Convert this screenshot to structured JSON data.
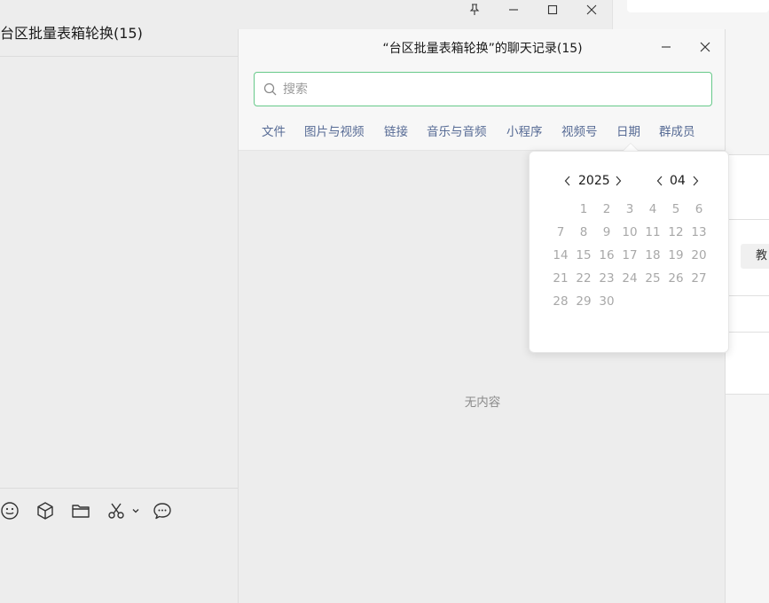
{
  "chat": {
    "title": "台区批量表箱轮换(15)"
  },
  "right_panel": {
    "chip_label": "教"
  },
  "dialog": {
    "title": "“台区批量表箱轮换”的聊天记录(15)",
    "search_placeholder": "搜索",
    "tabs": [
      "文件",
      "图片与视频",
      "链接",
      "音乐与音频",
      "小程序",
      "视频号",
      "日期",
      "群成员"
    ],
    "empty_text": "无内容"
  },
  "date_picker": {
    "year": "2025",
    "month": "04",
    "days": [
      [
        "",
        "1",
        "2",
        "3",
        "4",
        "5",
        "6"
      ],
      [
        "7",
        "8",
        "9",
        "10",
        "11",
        "12",
        "13"
      ],
      [
        "14",
        "15",
        "16",
        "17",
        "18",
        "19",
        "20"
      ],
      [
        "21",
        "22",
        "23",
        "24",
        "25",
        "26",
        "27"
      ],
      [
        "28",
        "29",
        "30",
        "",
        "",
        "",
        ""
      ]
    ]
  },
  "colors": {
    "accent_green": "#67c98a",
    "link_blue": "#576b95",
    "disabled_gray": "#a8a8a8"
  },
  "icons": {
    "window_controls": [
      "pin-icon",
      "minimize-icon",
      "maximize-icon",
      "close-icon"
    ],
    "toolbar": [
      "emoji-icon",
      "package-icon",
      "folder-icon",
      "scissors-icon",
      "chevron-down-icon",
      "chat-bubble-icon"
    ]
  }
}
